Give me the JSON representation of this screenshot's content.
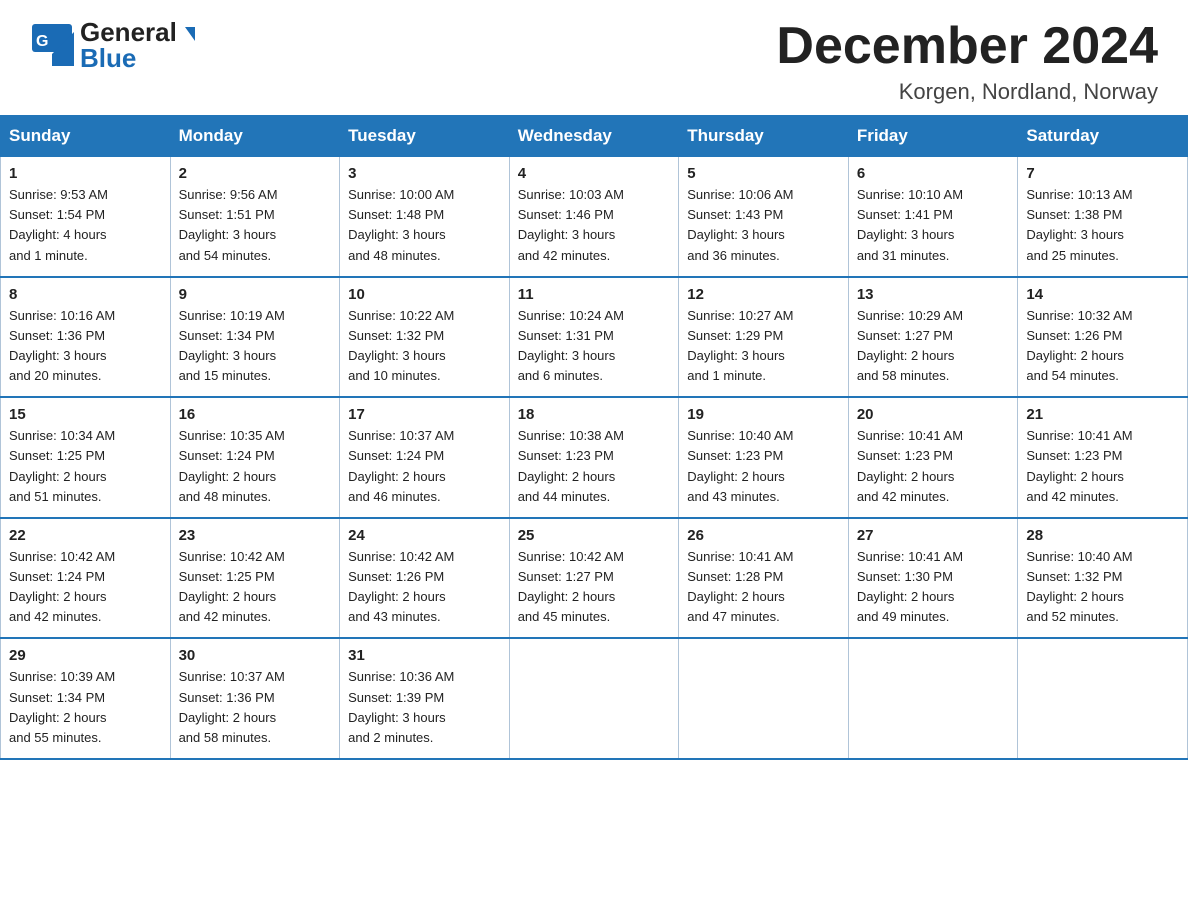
{
  "header": {
    "logo_general": "General",
    "logo_blue": "Blue",
    "month_title": "December 2024",
    "location": "Korgen, Nordland, Norway"
  },
  "weekdays": [
    "Sunday",
    "Monday",
    "Tuesday",
    "Wednesday",
    "Thursday",
    "Friday",
    "Saturday"
  ],
  "weeks": [
    [
      {
        "day": "1",
        "info": "Sunrise: 9:53 AM\nSunset: 1:54 PM\nDaylight: 4 hours\nand 1 minute."
      },
      {
        "day": "2",
        "info": "Sunrise: 9:56 AM\nSunset: 1:51 PM\nDaylight: 3 hours\nand 54 minutes."
      },
      {
        "day": "3",
        "info": "Sunrise: 10:00 AM\nSunset: 1:48 PM\nDaylight: 3 hours\nand 48 minutes."
      },
      {
        "day": "4",
        "info": "Sunrise: 10:03 AM\nSunset: 1:46 PM\nDaylight: 3 hours\nand 42 minutes."
      },
      {
        "day": "5",
        "info": "Sunrise: 10:06 AM\nSunset: 1:43 PM\nDaylight: 3 hours\nand 36 minutes."
      },
      {
        "day": "6",
        "info": "Sunrise: 10:10 AM\nSunset: 1:41 PM\nDaylight: 3 hours\nand 31 minutes."
      },
      {
        "day": "7",
        "info": "Sunrise: 10:13 AM\nSunset: 1:38 PM\nDaylight: 3 hours\nand 25 minutes."
      }
    ],
    [
      {
        "day": "8",
        "info": "Sunrise: 10:16 AM\nSunset: 1:36 PM\nDaylight: 3 hours\nand 20 minutes."
      },
      {
        "day": "9",
        "info": "Sunrise: 10:19 AM\nSunset: 1:34 PM\nDaylight: 3 hours\nand 15 minutes."
      },
      {
        "day": "10",
        "info": "Sunrise: 10:22 AM\nSunset: 1:32 PM\nDaylight: 3 hours\nand 10 minutes."
      },
      {
        "day": "11",
        "info": "Sunrise: 10:24 AM\nSunset: 1:31 PM\nDaylight: 3 hours\nand 6 minutes."
      },
      {
        "day": "12",
        "info": "Sunrise: 10:27 AM\nSunset: 1:29 PM\nDaylight: 3 hours\nand 1 minute."
      },
      {
        "day": "13",
        "info": "Sunrise: 10:29 AM\nSunset: 1:27 PM\nDaylight: 2 hours\nand 58 minutes."
      },
      {
        "day": "14",
        "info": "Sunrise: 10:32 AM\nSunset: 1:26 PM\nDaylight: 2 hours\nand 54 minutes."
      }
    ],
    [
      {
        "day": "15",
        "info": "Sunrise: 10:34 AM\nSunset: 1:25 PM\nDaylight: 2 hours\nand 51 minutes."
      },
      {
        "day": "16",
        "info": "Sunrise: 10:35 AM\nSunset: 1:24 PM\nDaylight: 2 hours\nand 48 minutes."
      },
      {
        "day": "17",
        "info": "Sunrise: 10:37 AM\nSunset: 1:24 PM\nDaylight: 2 hours\nand 46 minutes."
      },
      {
        "day": "18",
        "info": "Sunrise: 10:38 AM\nSunset: 1:23 PM\nDaylight: 2 hours\nand 44 minutes."
      },
      {
        "day": "19",
        "info": "Sunrise: 10:40 AM\nSunset: 1:23 PM\nDaylight: 2 hours\nand 43 minutes."
      },
      {
        "day": "20",
        "info": "Sunrise: 10:41 AM\nSunset: 1:23 PM\nDaylight: 2 hours\nand 42 minutes."
      },
      {
        "day": "21",
        "info": "Sunrise: 10:41 AM\nSunset: 1:23 PM\nDaylight: 2 hours\nand 42 minutes."
      }
    ],
    [
      {
        "day": "22",
        "info": "Sunrise: 10:42 AM\nSunset: 1:24 PM\nDaylight: 2 hours\nand 42 minutes."
      },
      {
        "day": "23",
        "info": "Sunrise: 10:42 AM\nSunset: 1:25 PM\nDaylight: 2 hours\nand 42 minutes."
      },
      {
        "day": "24",
        "info": "Sunrise: 10:42 AM\nSunset: 1:26 PM\nDaylight: 2 hours\nand 43 minutes."
      },
      {
        "day": "25",
        "info": "Sunrise: 10:42 AM\nSunset: 1:27 PM\nDaylight: 2 hours\nand 45 minutes."
      },
      {
        "day": "26",
        "info": "Sunrise: 10:41 AM\nSunset: 1:28 PM\nDaylight: 2 hours\nand 47 minutes."
      },
      {
        "day": "27",
        "info": "Sunrise: 10:41 AM\nSunset: 1:30 PM\nDaylight: 2 hours\nand 49 minutes."
      },
      {
        "day": "28",
        "info": "Sunrise: 10:40 AM\nSunset: 1:32 PM\nDaylight: 2 hours\nand 52 minutes."
      }
    ],
    [
      {
        "day": "29",
        "info": "Sunrise: 10:39 AM\nSunset: 1:34 PM\nDaylight: 2 hours\nand 55 minutes."
      },
      {
        "day": "30",
        "info": "Sunrise: 10:37 AM\nSunset: 1:36 PM\nDaylight: 2 hours\nand 58 minutes."
      },
      {
        "day": "31",
        "info": "Sunrise: 10:36 AM\nSunset: 1:39 PM\nDaylight: 3 hours\nand 2 minutes."
      },
      {
        "day": "",
        "info": ""
      },
      {
        "day": "",
        "info": ""
      },
      {
        "day": "",
        "info": ""
      },
      {
        "day": "",
        "info": ""
      }
    ]
  ]
}
